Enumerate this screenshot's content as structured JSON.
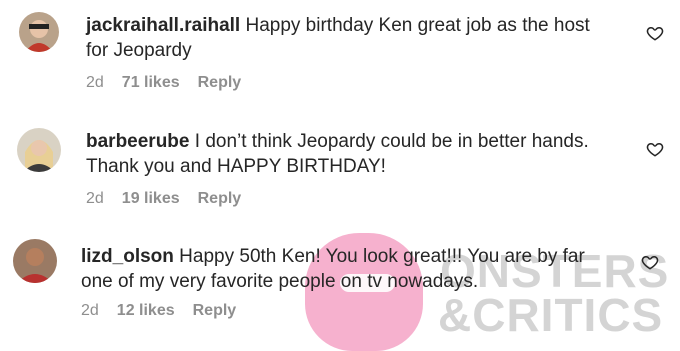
{
  "comments": [
    {
      "username": "jackraihall.raihall",
      "text_line1": " Happy birthday Ken great job as the host",
      "text_line2": "for Jeopardy",
      "age": "2d",
      "likes": "71 likes",
      "reply": "Reply"
    },
    {
      "username": "barbeerube",
      "text_line1": " I don’t think Jeopardy could be in better hands.",
      "text_line2": "Thank you and HAPPY BIRTHDAY!",
      "age": "2d",
      "likes": "19 likes",
      "reply": "Reply"
    },
    {
      "username": "lizd_olson",
      "text_line1": " Happy 50th Ken! You look great!!! You are by far",
      "text_line2": "one of my very favorite people on tv nowadays.",
      "age": "2d",
      "likes": "12 likes",
      "reply": "Reply"
    }
  ],
  "watermark": {
    "line1": "ONSTERS",
    "line2": "&CRITICS"
  },
  "icons": {
    "like": "heart-outline-icon",
    "avatar": "profile-avatar"
  }
}
